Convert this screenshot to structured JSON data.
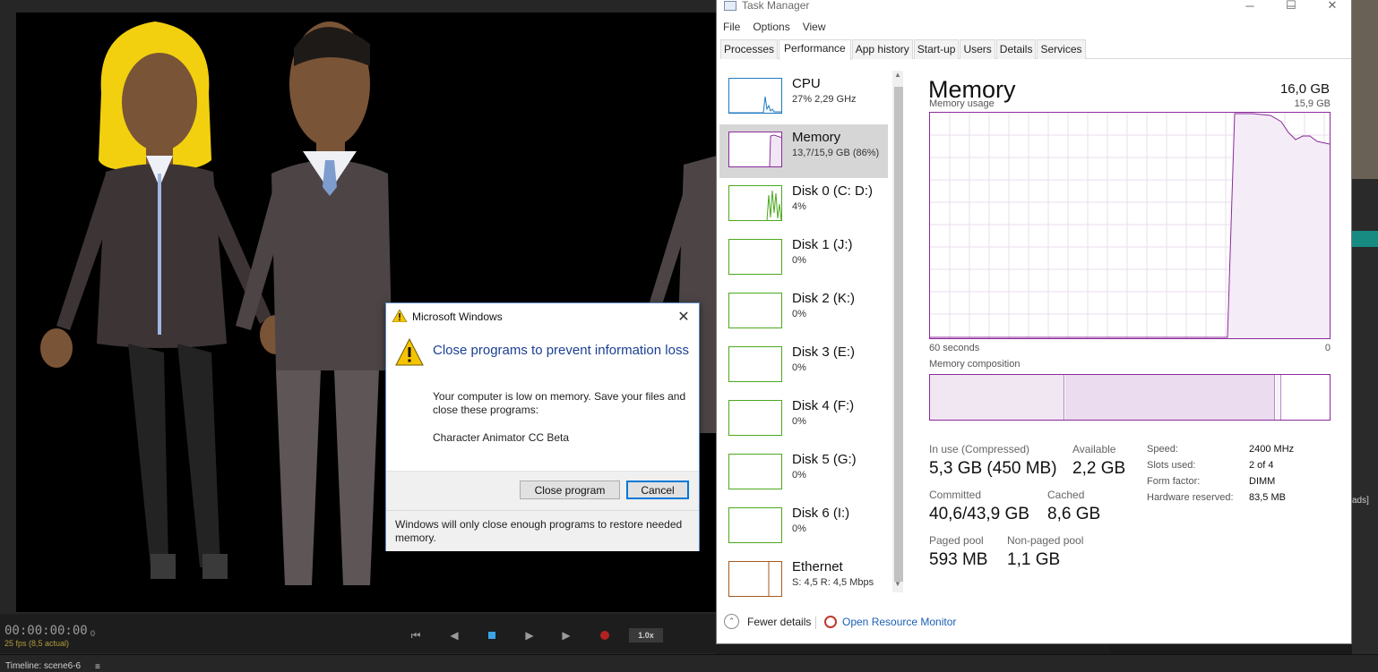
{
  "character_animator": {
    "timecode": "00:00:00:00",
    "frame": "0",
    "fps": "25 fps (8,5 actual)",
    "speed": "1.0x",
    "timeline_title": "Timeline: scene6-6",
    "right_panel_fragment": "ads]"
  },
  "task_manager": {
    "title": "Task Manager",
    "menu": [
      "File",
      "Options",
      "View"
    ],
    "tabs": [
      "Processes",
      "Performance",
      "App history",
      "Start-up",
      "Users",
      "Details",
      "Services"
    ],
    "active_tab": "Performance",
    "resources": [
      {
        "name": "CPU",
        "sub": "27% 2,29 GHz",
        "color": "#1e79c1"
      },
      {
        "name": "Memory",
        "sub": "13,7/15,9 GB (86%)",
        "color": "#8b2a9b"
      },
      {
        "name": "Disk 0 (C: D:)",
        "sub": "4%",
        "color": "#4ca81e"
      },
      {
        "name": "Disk 1 (J:)",
        "sub": "0%",
        "color": "#4ca81e"
      },
      {
        "name": "Disk 2 (K:)",
        "sub": "0%",
        "color": "#4ca81e"
      },
      {
        "name": "Disk 3 (E:)",
        "sub": "0%",
        "color": "#4ca81e"
      },
      {
        "name": "Disk 4 (F:)",
        "sub": "0%",
        "color": "#4ca81e"
      },
      {
        "name": "Disk 5 (G:)",
        "sub": "0%",
        "color": "#4ca81e"
      },
      {
        "name": "Disk 6 (I:)",
        "sub": "0%",
        "color": "#4ca81e"
      },
      {
        "name": "Ethernet",
        "sub": "S: 4,5  R: 4,5 Mbps",
        "color": "#a65a1c"
      }
    ],
    "memory": {
      "title": "Memory",
      "total": "16,0 GB",
      "usage_label": "Memory usage",
      "usage_max": "15,9 GB",
      "time_left": "60 seconds",
      "time_right": "0",
      "composition_label": "Memory composition",
      "in_use_label": "In use (Compressed)",
      "in_use_value": "5,3 GB (450 MB)",
      "available_label": "Available",
      "available_value": "2,2 GB",
      "committed_label": "Committed",
      "committed_value": "40,6/43,9 GB",
      "cached_label": "Cached",
      "cached_value": "8,6 GB",
      "paged_label": "Paged pool",
      "paged_value": "593 MB",
      "nonpaged_label": "Non-paged pool",
      "nonpaged_value": "1,1 GB",
      "speed_label": "Speed:",
      "speed_value": "2400 MHz",
      "slots_label": "Slots used:",
      "slots_value": "2 of 4",
      "form_label": "Form factor:",
      "form_value": "DIMM",
      "hwres_label": "Hardware reserved:",
      "hwres_value": "83,5 MB",
      "accent_color": "#8b2a9b"
    },
    "footer": {
      "fewer_details": "Fewer details",
      "open_resource_monitor": "Open Resource Monitor"
    }
  },
  "dialog": {
    "title": "Microsoft Windows",
    "heading": "Close programs to prevent information loss",
    "body": "Your computer is low on memory. Save your files and close these programs:",
    "program": "Character Animator CC Beta",
    "close_program": "Close program",
    "cancel": "Cancel",
    "footer": "Windows will only close enough programs to restore needed memory."
  }
}
